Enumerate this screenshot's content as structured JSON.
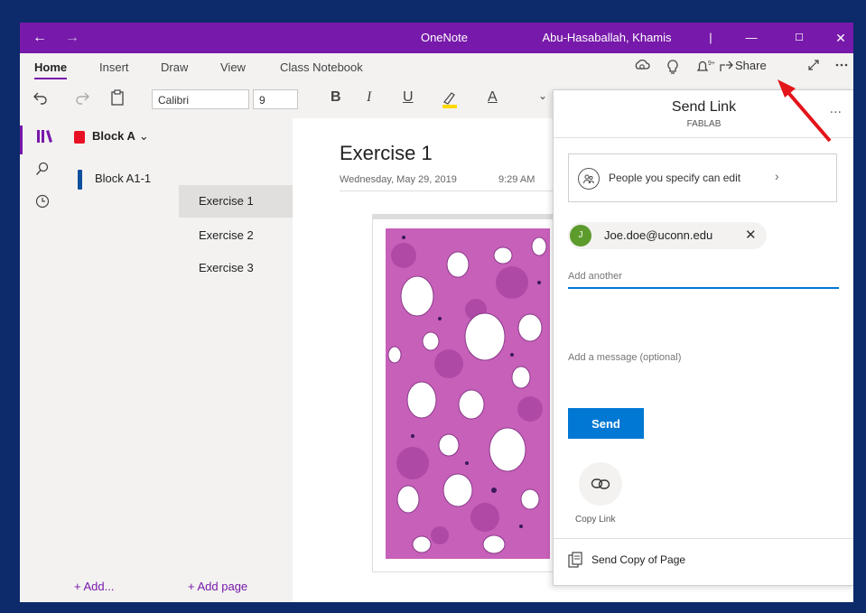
{
  "titlebar": {
    "back_icon": "←",
    "forward_icon": "→",
    "app_title": "OneNote",
    "user_name": "Abu-Hasaballah, Khamis",
    "separator": "|",
    "minimize_icon": "—",
    "maximize_icon": "☐",
    "close_icon": "✕"
  },
  "ribbon": {
    "tabs": [
      {
        "label": "Home"
      },
      {
        "label": "Insert"
      },
      {
        "label": "Draw"
      },
      {
        "label": "View"
      },
      {
        "label": "Class Notebook"
      }
    ],
    "share_label": "Share"
  },
  "toolbar": {
    "font_name": "Calibri",
    "font_size": "9",
    "bold_label": "B",
    "italic_label": "I",
    "underline_label": "U",
    "font_color_label": "A"
  },
  "notebook": {
    "name": "Block A",
    "sections": [
      {
        "label": "Block A1-1"
      }
    ],
    "add_section_label": "+ Add...",
    "add_page_label": "+ Add page"
  },
  "pages": [
    {
      "label": "Exercise 1"
    },
    {
      "label": "Exercise 2"
    },
    {
      "label": "Exercise 3"
    }
  ],
  "page": {
    "title": "Exercise 1",
    "date": "Wednesday, May 29, 2019",
    "time": "9:29 AM"
  },
  "share_pane": {
    "title": "Send Link",
    "subtitle": "FABLAB",
    "more": "...",
    "permission_text": "People you specify can edit",
    "recipient_initial": "J",
    "recipient": "Joe.doe@uconn.edu",
    "add_placeholder": "Add another",
    "message_placeholder": "Add a message (optional)",
    "send_label": "Send",
    "copy_link_label": "Copy Link",
    "send_copy_label": "Send Copy of Page"
  },
  "colors": {
    "brand_purple": "#7719aa",
    "send_blue": "#0078d4",
    "annotation_red": "#e3151a"
  }
}
